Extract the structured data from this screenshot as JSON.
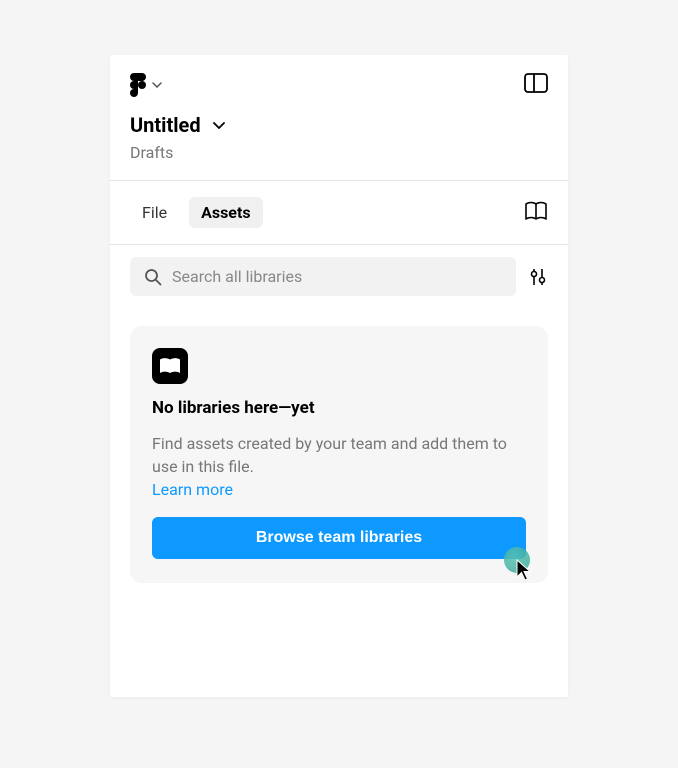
{
  "header": {
    "title": "Untitled",
    "subtitle": "Drafts"
  },
  "tabs": {
    "file": "File",
    "assets": "Assets"
  },
  "search": {
    "placeholder": "Search all libraries"
  },
  "emptyState": {
    "title": "No libraries here—yet",
    "description": "Find assets created by your team and add them to use in this file.",
    "learnMore": "Learn more",
    "browseButton": "Browse team libraries"
  }
}
